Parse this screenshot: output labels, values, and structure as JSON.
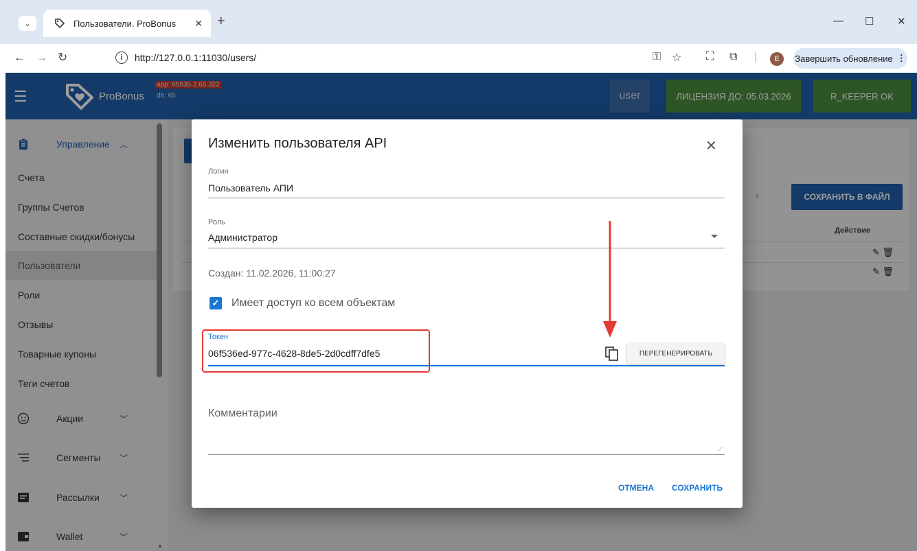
{
  "browser": {
    "tab_title": "Пользователи. ProBonus",
    "url": "http://127.0.0.1:11030/users/",
    "profile_initial": "E",
    "update_button": "Завершить обновление",
    "update_menu": "⋮"
  },
  "header": {
    "brand": "ProBonus",
    "version_app": "app: 65535.2.65.322",
    "version_db": "db: 65",
    "user_button": "user",
    "license_button": "ЛИЦЕНЗИЯ ДО: 05.03.2026",
    "rkeeper_button": "R_KEEPER OK",
    "colors": {
      "primary": "#1f5ea8",
      "ok_green": "#4b8a3c"
    }
  },
  "sidebar": {
    "management_group": "Управление",
    "items": [
      {
        "label": "Счета"
      },
      {
        "label": "Группы Счетов"
      },
      {
        "label": "Составные скидки/бонусы"
      },
      {
        "label": "Пользователи"
      },
      {
        "label": "Роли"
      },
      {
        "label": "Отзывы"
      },
      {
        "label": "Товарные купоны"
      },
      {
        "label": "Теги счетов"
      }
    ],
    "groups": [
      {
        "label": "Акции",
        "icon": "smile-icon"
      },
      {
        "label": "Сегменты",
        "icon": "segments-icon"
      },
      {
        "label": "Рассылки",
        "icon": "mail-icon"
      },
      {
        "label": "Wallet",
        "icon": "wallet-icon"
      }
    ]
  },
  "page": {
    "save_file_button": "СОХРАНИТЬ В ФАЙЛ",
    "action_column": "Действие"
  },
  "dialog": {
    "title": "Изменить пользователя API",
    "login_label": "Логин",
    "login_value": "Пользователь АПИ",
    "role_label": "Роль",
    "role_value": "Администратор",
    "created": "Создан: 11.02.2026, 11:00:27",
    "access_all_label": "Имеет доступ ко всем объектам",
    "access_all_checked": true,
    "token_label": "Токен",
    "token_value": "06f536ed-977c-4628-8de5-2d0cdff7dfe5",
    "regenerate_button": "ПЕРЕГЕНЕРИРОВАТЬ",
    "comments_label": "Комментарии",
    "cancel_button": "ОТМЕНА",
    "save_button": "СОХРАНИТЬ",
    "accent_color": "#1976d2"
  }
}
